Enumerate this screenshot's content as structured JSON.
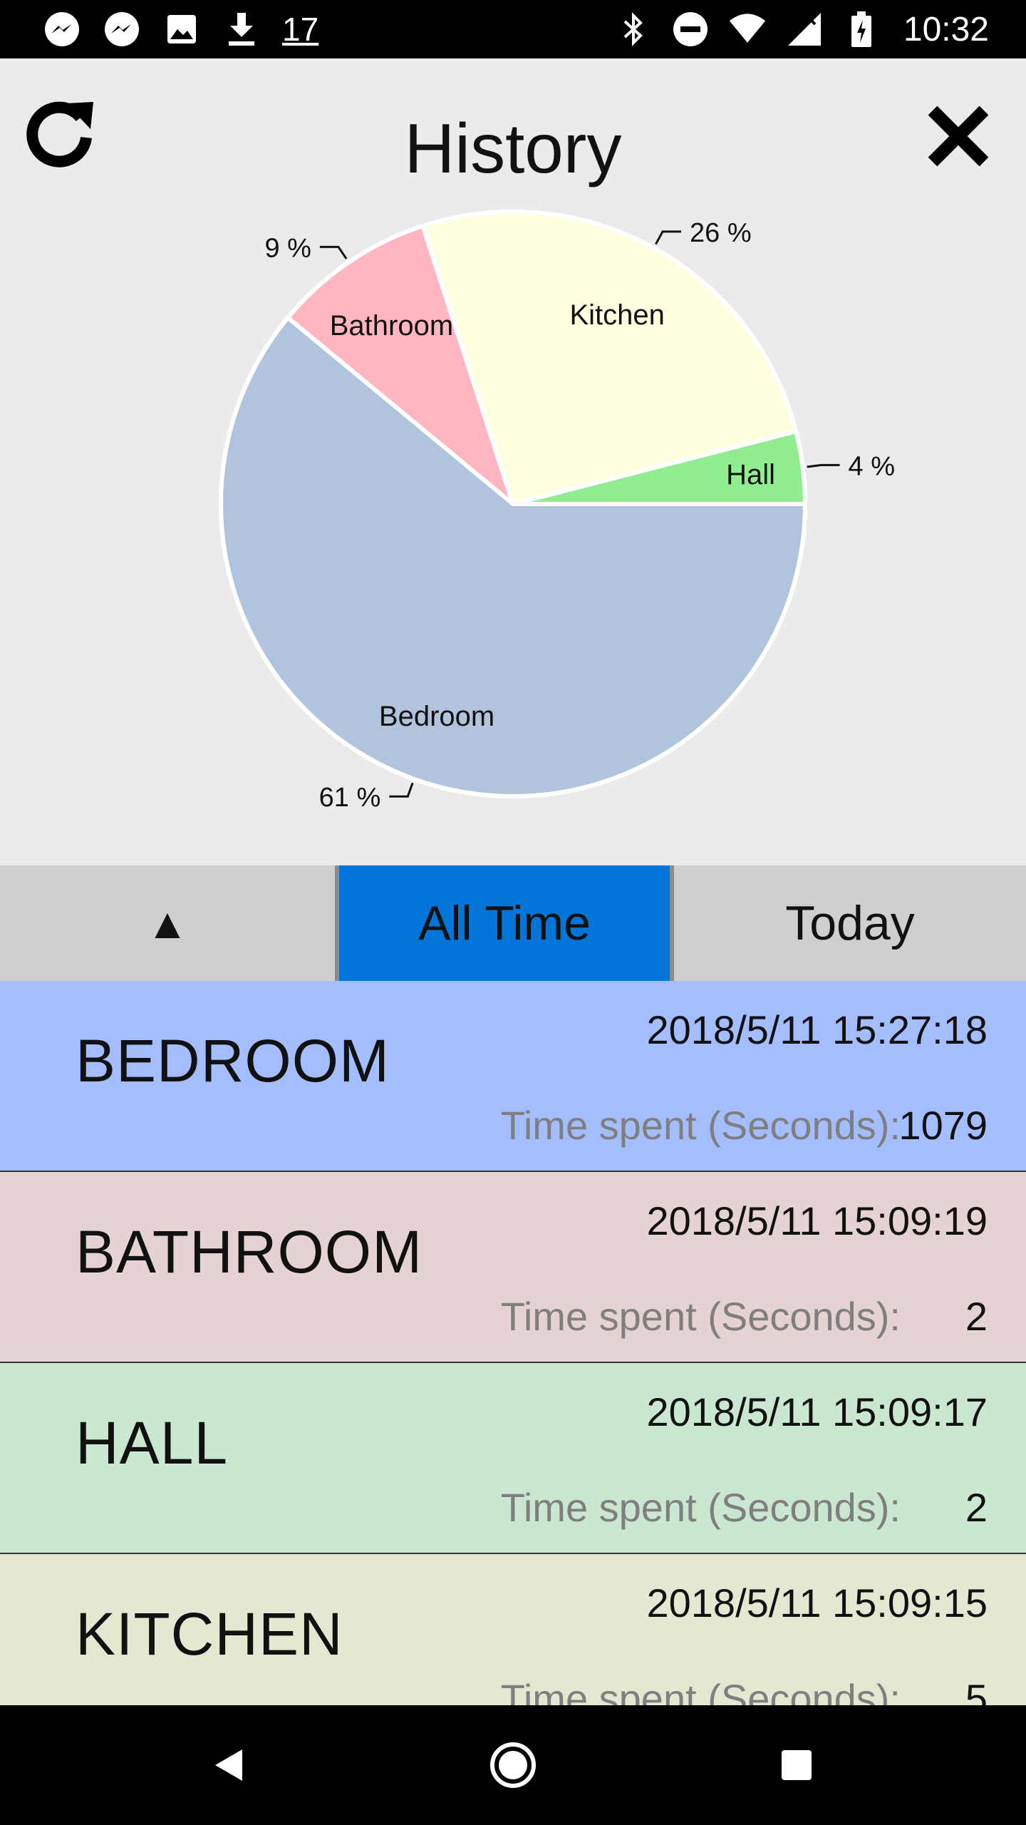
{
  "status_bar": {
    "left_icons": [
      "messenger-icon",
      "messenger-icon",
      "image-icon",
      "download-icon"
    ],
    "calendar_date": "17",
    "right_icons": [
      "bluetooth-icon",
      "do-not-disturb-icon",
      "wifi-icon",
      "no-signal-icon",
      "battery-charging-icon"
    ],
    "time": "10:32"
  },
  "header": {
    "title": "History",
    "refresh_icon": "refresh-icon",
    "close_icon": "close-icon"
  },
  "chart_data": {
    "type": "pie",
    "title": "",
    "slices": [
      {
        "label": "Hall",
        "value": 4,
        "percent_label": "4 %",
        "color": "#90ee90"
      },
      {
        "label": "Kitchen",
        "value": 26,
        "percent_label": "26 %",
        "color": "#ffffe0"
      },
      {
        "label": "Bathroom",
        "value": 9,
        "percent_label": "9 %",
        "color": "#ffb6c1"
      },
      {
        "label": "Bedroom",
        "value": 61,
        "percent_label": "61 %",
        "color": "#b0c4de"
      }
    ]
  },
  "tabs": {
    "sort_label": "▲",
    "all_time_label": "All Time",
    "today_label": "Today",
    "active_color": "#0275d8"
  },
  "rows": [
    {
      "room": "BEDROOM",
      "timestamp": "2018/5/11 15:27:18",
      "time_label": "Time spent (Seconds):",
      "time_value": "1079",
      "color": "#a4bdff"
    },
    {
      "room": "BATHROOM",
      "timestamp": "2018/5/11 15:09:19",
      "time_label": "Time spent (Seconds):",
      "time_value": "2",
      "color": "#e5d2d2"
    },
    {
      "room": "HALL",
      "timestamp": "2018/5/11 15:09:17",
      "time_label": "Time spent (Seconds):",
      "time_value": "2",
      "color": "#c9e7d1"
    },
    {
      "room": "KITCHEN",
      "timestamp": "2018/5/11 15:09:15",
      "time_label": "Time spent (Seconds):",
      "time_value": "5",
      "color": "#e6e7d1"
    }
  ],
  "nav_bar": {
    "back_icon": "back-icon",
    "home_icon": "home-icon",
    "recents_icon": "recents-icon"
  }
}
